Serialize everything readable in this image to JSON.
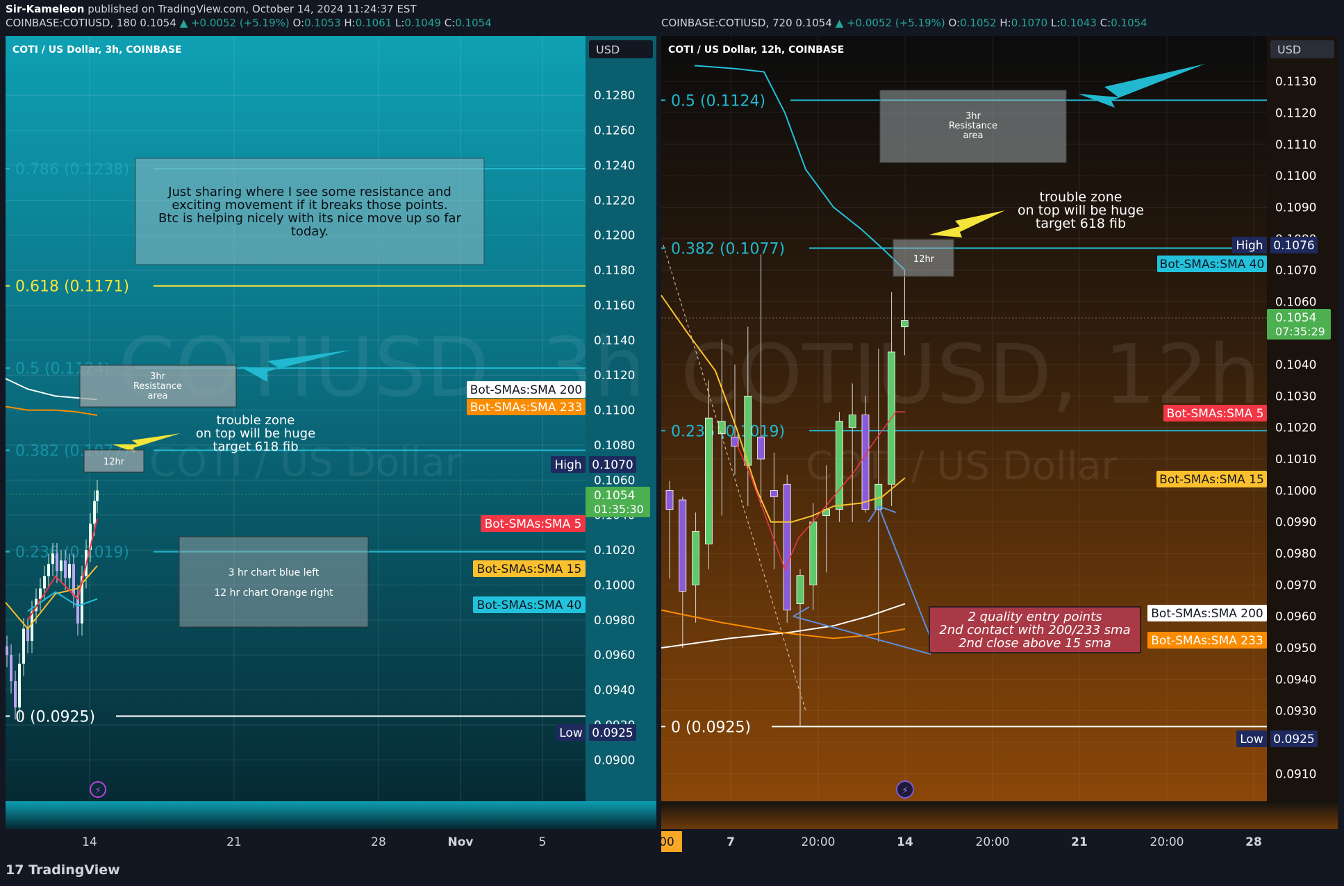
{
  "header": {
    "author": "Sir-Kameleon",
    "published": "published on TradingView.com, October 14, 2024 11:24:37 EST"
  },
  "footer": {
    "logo_text": "TradingView"
  },
  "colors": {
    "left_bg_top": "#0fa0b4",
    "left_bg_bottom": "#062a33",
    "right_bg_top": "#0b0c0d",
    "right_bg_bottom": "#8a4708",
    "fib": "#22b8cf",
    "fib_golden": "#f5e43a",
    "up": "#5fc86a",
    "down": "#8a5bd6",
    "sma5": "#f23645",
    "sma15": "#fbc02d",
    "sma40": "#22c2dc",
    "sma200": "#ffffff",
    "sma233": "#fb8c00"
  },
  "chart_data": [
    {
      "type": "line",
      "symbol_line": "COINBASE:COTIUSD, 180",
      "quote": {
        "last": "0.1054",
        "change": "▲ +0.0052 (+5.19%)",
        "o": "0.1053",
        "h": "0.1061",
        "l": "0.1049",
        "c": "0.1054"
      },
      "legend_title": "COTI / US Dollar, 3h, COINBASE",
      "watermark": "COTIUSD, 3h",
      "watermark_sub": "COTI / US Dollar",
      "currency": "USD",
      "y_ticks": [
        "0.1280",
        "0.1260",
        "0.1240",
        "0.1220",
        "0.1200",
        "0.1180",
        "0.1160",
        "0.1140",
        "0.1120",
        "0.1100",
        "0.1080",
        "0.1060",
        "0.1040",
        "0.1020",
        "0.1000",
        "0.0980",
        "0.0960",
        "0.0940",
        "0.0920",
        "0.0900"
      ],
      "ylim": [
        0.0891,
        0.129
      ],
      "x_ticks": [
        "14",
        "21",
        "28",
        "Nov",
        "5"
      ],
      "fib_levels": [
        {
          "label": "0.786 (0.1238)",
          "value": 0.1238
        },
        {
          "label": "0.618 (0.1171)",
          "value": 0.1171
        },
        {
          "label": "0.5 (0.1124)",
          "value": 0.1124
        },
        {
          "label": "0.382 (0.1077)",
          "value": 0.1077
        },
        {
          "label": "0.236 (0.1019)",
          "value": 0.1019
        },
        {
          "label": "0 (0.0925)",
          "value": 0.0925
        }
      ],
      "price_tags": [
        {
          "label": "High",
          "value": "0.1070"
        },
        {
          "label": "Low",
          "value": "0.0925"
        },
        {
          "label": "current",
          "value": "0.1054",
          "countdown": "01:35:30"
        }
      ],
      "sma_labels": [
        {
          "name": "Bot-SMAs:SMA 200",
          "value": 0.1106
        },
        {
          "name": "Bot-SMAs:SMA 233",
          "value": 0.1097
        },
        {
          "name": "Bot-SMAs:SMA 5",
          "value": 0.1038
        },
        {
          "name": "Bot-SMAs:SMA 15",
          "value": 0.1011
        },
        {
          "name": "Bot-SMAs:SMA 40",
          "value": 0.0992
        }
      ],
      "annotations": {
        "note": [
          "Just sharing where I see some resistance and",
          "exciting movement if it breaks those points.",
          "Btc is helping nicely with its nice move up so far",
          "today."
        ],
        "resistance": [
          "3hr",
          "Resistance",
          "area"
        ],
        "trouble": [
          "trouble zone",
          "on top will be huge",
          "target 618 fib"
        ],
        "box12": "12hr",
        "legend_note": [
          "3 hr chart blue left",
          "12 hr chart Orange right"
        ]
      }
    },
    {
      "type": "line",
      "symbol_line": "COINBASE:COTIUSD, 720",
      "quote": {
        "last": "0.1054",
        "change": "▲ +0.0052 (+5.19%)",
        "o": "0.1052",
        "h": "0.1070",
        "l": "0.1043",
        "c": "0.1054"
      },
      "legend_title": "COTI / US Dollar, 12h, COINBASE",
      "watermark": "COTIUSD, 12h",
      "watermark_sub": "COTI / US Dollar",
      "currency": "USD",
      "y_ticks": [
        "0.1130",
        "0.1120",
        "0.1110",
        "0.1100",
        "0.1090",
        "0.1080",
        "0.1070",
        "0.1060",
        "0.1050",
        "0.1040",
        "0.1030",
        "0.1020",
        "0.1010",
        "0.1000",
        "0.0990",
        "0.0980",
        "0.0970",
        "0.0960",
        "0.0950",
        "0.0940",
        "0.0930",
        "0.0920",
        "0.0910"
      ],
      "ylim": [
        0.0905,
        0.1134
      ],
      "x_ticks": [
        "00",
        "7",
        "20:00",
        "14",
        "20:00",
        "21",
        "20:00",
        "28"
      ],
      "fib_levels": [
        {
          "label": "0.5 (0.1124)",
          "value": 0.1124
        },
        {
          "label": "0.382 (0.1077)",
          "value": 0.1077
        },
        {
          "label": "0.236 (0.1019)",
          "value": 0.1019
        },
        {
          "label": "0 (0.0925)",
          "value": 0.0925
        }
      ],
      "price_tags": [
        {
          "label": "High",
          "value": "0.1076"
        },
        {
          "label": "Low",
          "value": "0.0925"
        },
        {
          "label": "current",
          "value": "0.1054",
          "countdown": "07:35:29"
        }
      ],
      "sma_labels": [
        {
          "name": "Bot-SMAs:SMA 40",
          "value": 0.107
        },
        {
          "name": "Bot-SMAs:SMA 5",
          "value": 0.1025
        },
        {
          "name": "Bot-SMAs:SMA 15",
          "value": 0.1004
        },
        {
          "name": "Bot-SMAs:SMA 200",
          "value": 0.0964
        },
        {
          "name": "Bot-SMAs:SMA 233",
          "value": 0.0958
        }
      ],
      "candles": [
        {
          "o": 0.1,
          "h": 0.1003,
          "l": 0.0972,
          "c": 0.0994
        },
        {
          "o": 0.0997,
          "h": 0.0998,
          "l": 0.095,
          "c": 0.0968
        },
        {
          "o": 0.097,
          "h": 0.0993,
          "l": 0.0958,
          "c": 0.0987
        },
        {
          "o": 0.0983,
          "h": 0.1035,
          "l": 0.0975,
          "c": 0.1023
        },
        {
          "o": 0.1018,
          "h": 0.1048,
          "l": 0.0992,
          "c": 0.1022
        },
        {
          "o": 0.1017,
          "h": 0.104,
          "l": 0.1005,
          "c": 0.1014
        },
        {
          "o": 0.1008,
          "h": 0.1052,
          "l": 0.0995,
          "c": 0.103
        },
        {
          "o": 0.1017,
          "h": 0.1075,
          "l": 0.0995,
          "c": 0.101
        },
        {
          "o": 0.1,
          "h": 0.1012,
          "l": 0.0975,
          "c": 0.0998
        },
        {
          "o": 0.1002,
          "h": 0.1005,
          "l": 0.0958,
          "c": 0.0962
        },
        {
          "o": 0.0964,
          "h": 0.0975,
          "l": 0.0925,
          "c": 0.0973
        },
        {
          "o": 0.097,
          "h": 0.0996,
          "l": 0.0962,
          "c": 0.099
        },
        {
          "o": 0.0992,
          "h": 0.1008,
          "l": 0.0974,
          "c": 0.0994
        },
        {
          "o": 0.0994,
          "h": 0.1025,
          "l": 0.099,
          "c": 0.1022
        },
        {
          "o": 0.102,
          "h": 0.1034,
          "l": 0.099,
          "c": 0.1024
        },
        {
          "o": 0.1024,
          "h": 0.103,
          "l": 0.0993,
          "c": 0.0994
        },
        {
          "o": 0.0994,
          "h": 0.1045,
          "l": 0.0952,
          "c": 0.1002
        },
        {
          "o": 0.1002,
          "h": 0.1063,
          "l": 0.0995,
          "c": 0.1044
        },
        {
          "o": 0.1052,
          "h": 0.107,
          "l": 0.1043,
          "c": 0.1054
        }
      ],
      "annotations": {
        "resistance": [
          "3hr",
          "Resistance",
          "area"
        ],
        "trouble": [
          "trouble zone",
          "on top will be huge",
          "target 618 fib"
        ],
        "box12": "12hr",
        "entry": [
          "2 quality entry points",
          "2nd contact with 200/233 sma",
          "2nd close above 15 sma"
        ]
      }
    }
  ]
}
